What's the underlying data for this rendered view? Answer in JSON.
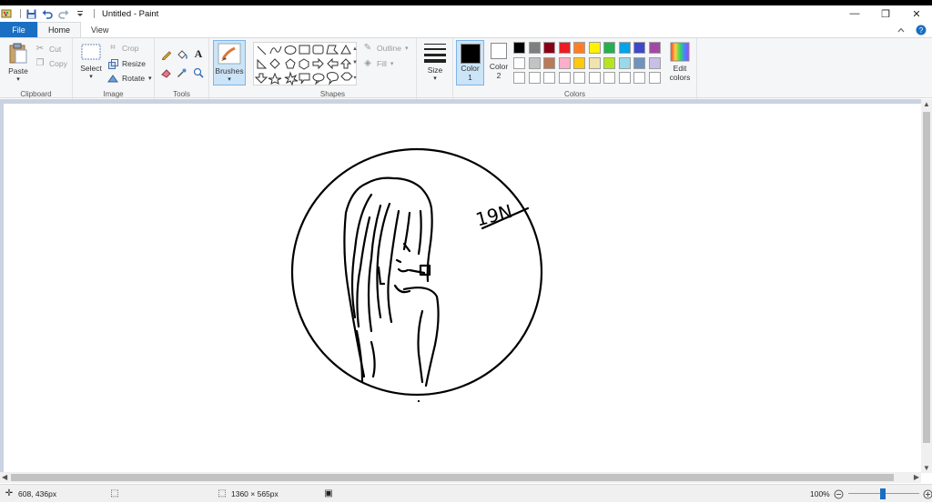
{
  "window": {
    "title": "Untitled - Paint",
    "controls": {
      "minimize": "—",
      "maximize": "❐",
      "close": "✕"
    }
  },
  "quick_access": {
    "save_icon": "save-icon",
    "undo_icon": "undo-icon",
    "redo_icon": "redo-icon",
    "customize_icon": "dropdown-arrow-icon"
  },
  "tabs": {
    "file": "File",
    "home": "Home",
    "view": "View"
  },
  "ribbon": {
    "clipboard": {
      "paste": "Paste",
      "cut": "Cut",
      "copy": "Copy",
      "label": "Clipboard"
    },
    "image": {
      "select": "Select",
      "crop": "Crop",
      "resize": "Resize",
      "rotate": "Rotate",
      "label": "Image"
    },
    "tools": {
      "label": "Tools"
    },
    "brushes": {
      "label": "Brushes"
    },
    "shapes": {
      "outline": "Outline",
      "fill": "Fill",
      "label": "Shapes"
    },
    "size": {
      "label": "Size"
    },
    "color1": {
      "label1": "Color",
      "label2": "1"
    },
    "color2": {
      "label1": "Color",
      "label2": "2"
    },
    "colors": {
      "label": "Colors",
      "edit_label1": "Edit",
      "edit_label2": "colors",
      "color1_value": "#000000",
      "color2_value": "#ffffff",
      "palette_row1": [
        "#000000",
        "#7f7f7f",
        "#880015",
        "#ed1c24",
        "#ff7f27",
        "#fff200",
        "#22b14c",
        "#00a2e8",
        "#3f48cc",
        "#a349a4"
      ],
      "palette_row2": [
        "#ffffff",
        "#c3c3c3",
        "#b97a57",
        "#ffaec9",
        "#ffc90e",
        "#efe4b0",
        "#b5e61d",
        "#99d9ea",
        "#7092be",
        "#c8bfe7"
      ],
      "palette_row3": [
        "#ffffff",
        "#ffffff",
        "#ffffff",
        "#ffffff",
        "#ffffff",
        "#ffffff",
        "#ffffff",
        "#ffffff",
        "#ffffff",
        "#ffffff"
      ]
    }
  },
  "canvas": {
    "drawing_text": "19N",
    "dot_visible": true
  },
  "status": {
    "cursor_pos": "608, 436px",
    "image_size": "1360 × 565px",
    "zoom": "100%"
  }
}
